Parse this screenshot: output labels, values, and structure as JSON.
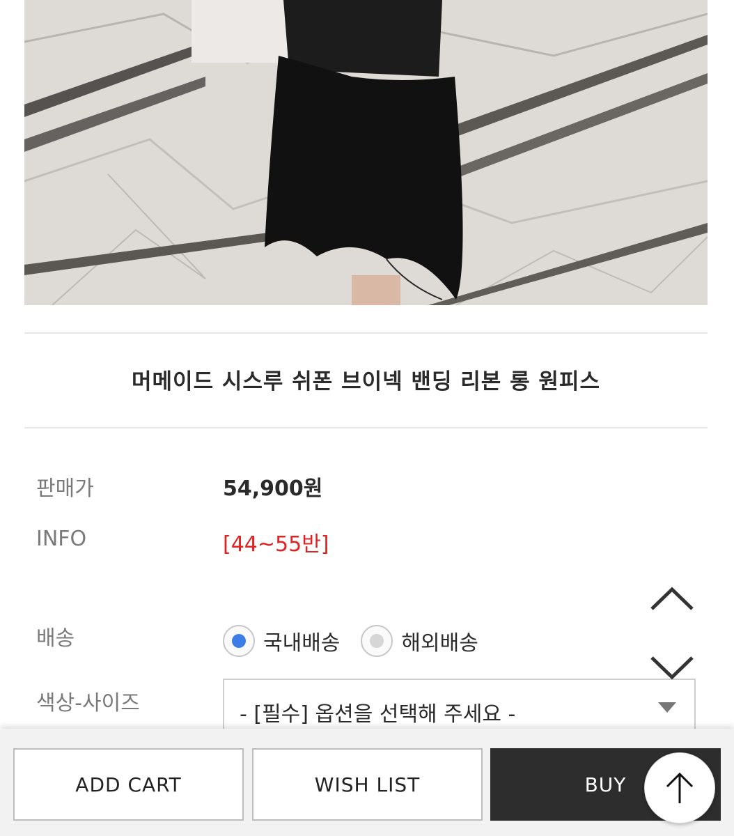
{
  "product": {
    "image_name": "product-photo",
    "title": "머메이드 시스루 쉬폰 브이넥 밴딩 리본 롱 원피스"
  },
  "details": {
    "price_label": "판매가",
    "price_value": "54,900원",
    "info_label": "INFO",
    "info_value": "[44~55반]",
    "shipping_label": "배송",
    "shipping_options": [
      "국내배송",
      "해외배송"
    ],
    "shipping_selected": "국내배송",
    "option_label": "색상-사이즈",
    "option_select_value": "- [필수] 옵션을 선택해 주세요 -"
  },
  "actions": {
    "add_cart": "ADD CART",
    "wish_list": "WISH LIST",
    "buy": "BUY"
  },
  "icons": {
    "scroll_up": "chevron-up-icon",
    "scroll_down": "chevron-down-icon",
    "back_to_top": "arrow-up-icon"
  },
  "colors": {
    "info_accent": "#e02222",
    "radio_selected": "#3d7ee6",
    "buy_button": "#2d2d2d"
  }
}
